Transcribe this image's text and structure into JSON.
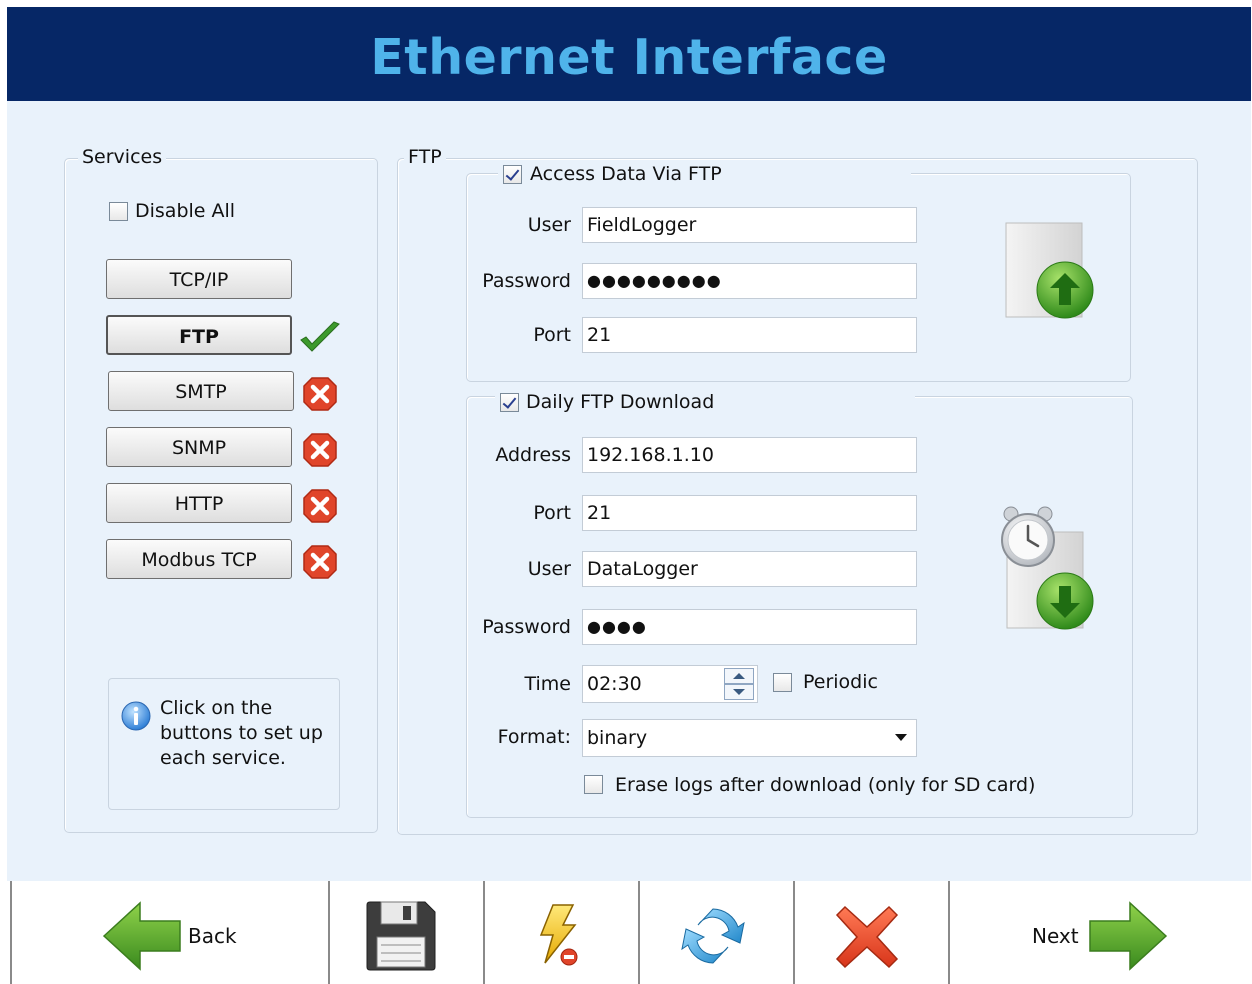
{
  "header": {
    "title": "Ethernet Interface"
  },
  "services": {
    "group_label": "Services",
    "disable_all_label": "Disable All",
    "disable_all_checked": false,
    "buttons": [
      {
        "label": "TCP/IP",
        "status": "none"
      },
      {
        "label": "FTP",
        "status": "enabled"
      },
      {
        "label": "SMTP",
        "status": "disabled"
      },
      {
        "label": "SNMP",
        "status": "disabled"
      },
      {
        "label": "HTTP",
        "status": "disabled"
      },
      {
        "label": "Modbus TCP",
        "status": "disabled"
      }
    ],
    "info_text": "Click on the buttons to set up each service.",
    "info_line1": "Click on the",
    "info_line2": "buttons to set up",
    "info_line3": "each service."
  },
  "ftp": {
    "group_label": "FTP",
    "access": {
      "checkbox_label": "Access Data Via FTP",
      "checked": true,
      "user_label": "User",
      "user_value": "FieldLogger",
      "password_label": "Password",
      "password_value": "●●●●●●●●●",
      "port_label": "Port",
      "port_value": "21"
    },
    "daily": {
      "checkbox_label": "Daily FTP Download",
      "checked": true,
      "address_label": "Address",
      "address_value": "192.168.1.10",
      "port_label": "Port",
      "port_value": "21",
      "user_label": "User",
      "user_value": "DataLogger",
      "password_label": "Password",
      "password_value": "●●●●",
      "time_label": "Time",
      "time_value": "02:30",
      "periodic_label": "Periodic",
      "periodic_checked": false,
      "format_label": "Format:",
      "format_value": "binary",
      "erase_label": "Erase logs after download (only for SD card)",
      "erase_checked": false
    }
  },
  "toolbar": {
    "back_label": "Back",
    "next_label": "Next"
  },
  "icons": {
    "upload": "upload-document-icon",
    "scheduled_download": "scheduled-download-icon",
    "save": "floppy-disk-icon",
    "apply": "lightning-config-icon",
    "refresh": "refresh-icon",
    "cancel": "red-x-icon"
  },
  "colors": {
    "header_bg": "#062766",
    "title": "#4fb3ea",
    "panel_bg": "#e9f2fb",
    "ok_green": "#3c9a2c",
    "err_red": "#e0452a"
  }
}
